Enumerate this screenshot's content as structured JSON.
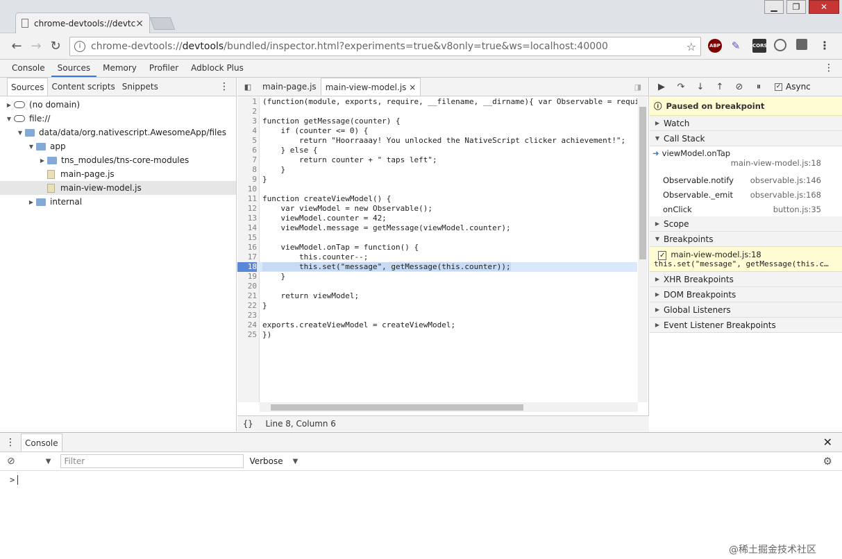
{
  "browser": {
    "tab_title": "chrome-devtools://devtc",
    "tab_close": "×",
    "url_prefix": "chrome-devtools://",
    "url_host": "devtools",
    "url_rest": "/bundled/inspector.html?experiments=true&v8only=true&ws=localhost:40000",
    "extensions": [
      "ABP",
      "CORS"
    ],
    "window_buttons": [
      "▁",
      "❐",
      "✕"
    ]
  },
  "devtools_tabs": [
    "Console",
    "Sources",
    "Memory",
    "Profiler",
    "Adblock Plus"
  ],
  "active_devtools_tab": "Sources",
  "navigator": {
    "tabs": [
      "Sources",
      "Content scripts",
      "Snippets"
    ],
    "tree": [
      {
        "label": "(no domain)",
        "type": "cloud",
        "indent": 0,
        "expanded": false
      },
      {
        "label": "file://",
        "type": "cloud",
        "indent": 0,
        "expanded": true
      },
      {
        "label": "data/data/org.nativescript.AwesomeApp/files",
        "type": "folder",
        "indent": 1,
        "expanded": true
      },
      {
        "label": "app",
        "type": "folder",
        "indent": 2,
        "expanded": true
      },
      {
        "label": "tns_modules/tns-core-modules",
        "type": "folder",
        "indent": 3,
        "expanded": false
      },
      {
        "label": "main-page.js",
        "type": "file",
        "indent": 3
      },
      {
        "label": "main-view-model.js",
        "type": "file",
        "indent": 3,
        "selected": true
      },
      {
        "label": "internal",
        "type": "folder",
        "indent": 2,
        "expanded": false
      }
    ]
  },
  "editor": {
    "tabs": [
      "main-page.js",
      "main-view-model.js"
    ],
    "active_tab": "main-view-model.js",
    "tab_close": "×",
    "status": "Line 8, Column 6",
    "breakpoint_line": 18,
    "lines": [
      "(function(module, exports, require, __filename, __dirname){ var Observable = requi",
      "",
      "function getMessage(counter) {",
      "    if (counter <= 0) {",
      "        return \"Hoorraaay! You unlocked the NativeScript clicker achievement!\";",
      "    } else {",
      "        return counter + \" taps left\";",
      "    }",
      "}",
      "",
      "function createViewModel() {",
      "    var viewModel = new Observable();",
      "    viewModel.counter = 42;",
      "    viewModel.message = getMessage(viewModel.counter);",
      "",
      "    viewModel.onTap = function() {",
      "        this.counter--;",
      "        this.set(\"message\", getMessage(this.counter));",
      "    }",
      "",
      "    return viewModel;",
      "}",
      "",
      "exports.createViewModel = createViewModel;",
      "})"
    ]
  },
  "debugger": {
    "async_label": "Async",
    "paused_message": "Paused on breakpoint",
    "watch": "Watch",
    "call_stack": "Call Stack",
    "frames": [
      {
        "name": "viewModel.onTap",
        "location": "main-view-model.js:18",
        "current": true
      },
      {
        "name": "Observable.notify",
        "location": "observable.js:146"
      },
      {
        "name": "Observable._emit",
        "location": "observable.js:168"
      },
      {
        "name": "onClick",
        "location": "button.js:35"
      }
    ],
    "scope": "Scope",
    "breakpoints": "Breakpoints",
    "breakpoint_item": {
      "file": "main-view-model.js:18",
      "code": "this.set(\"message\", getMessage(this.c…"
    },
    "xhr": "XHR Breakpoints",
    "dom": "DOM Breakpoints",
    "global": "Global Listeners",
    "event": "Event Listener Breakpoints"
  },
  "drawer": {
    "tab": "Console",
    "filter_placeholder": "Filter",
    "level": "Verbose",
    "prompt": ">"
  },
  "watermark": "@稀土掘金技术社区"
}
